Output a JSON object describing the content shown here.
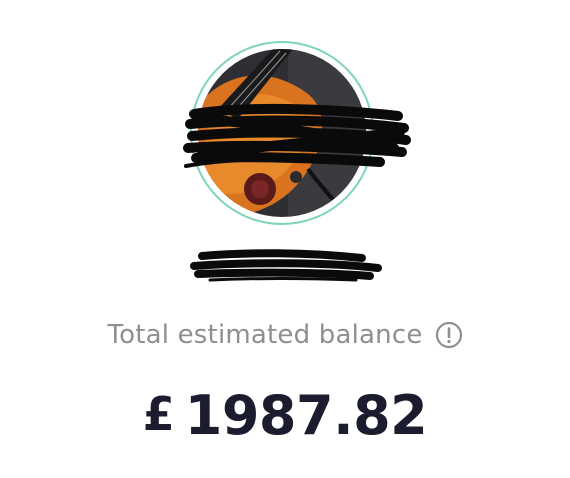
{
  "profile": {
    "avatar_ring_color": "#7fd3bf",
    "name_redacted": true,
    "handle_redacted": true
  },
  "balance": {
    "label": "Total estimated balance",
    "info_icon": "info-circle-icon",
    "currency_symbol": "£",
    "amount": "1987.82"
  },
  "colors": {
    "label_text": "#8e8e93",
    "amount_text": "#1b1c2e"
  }
}
